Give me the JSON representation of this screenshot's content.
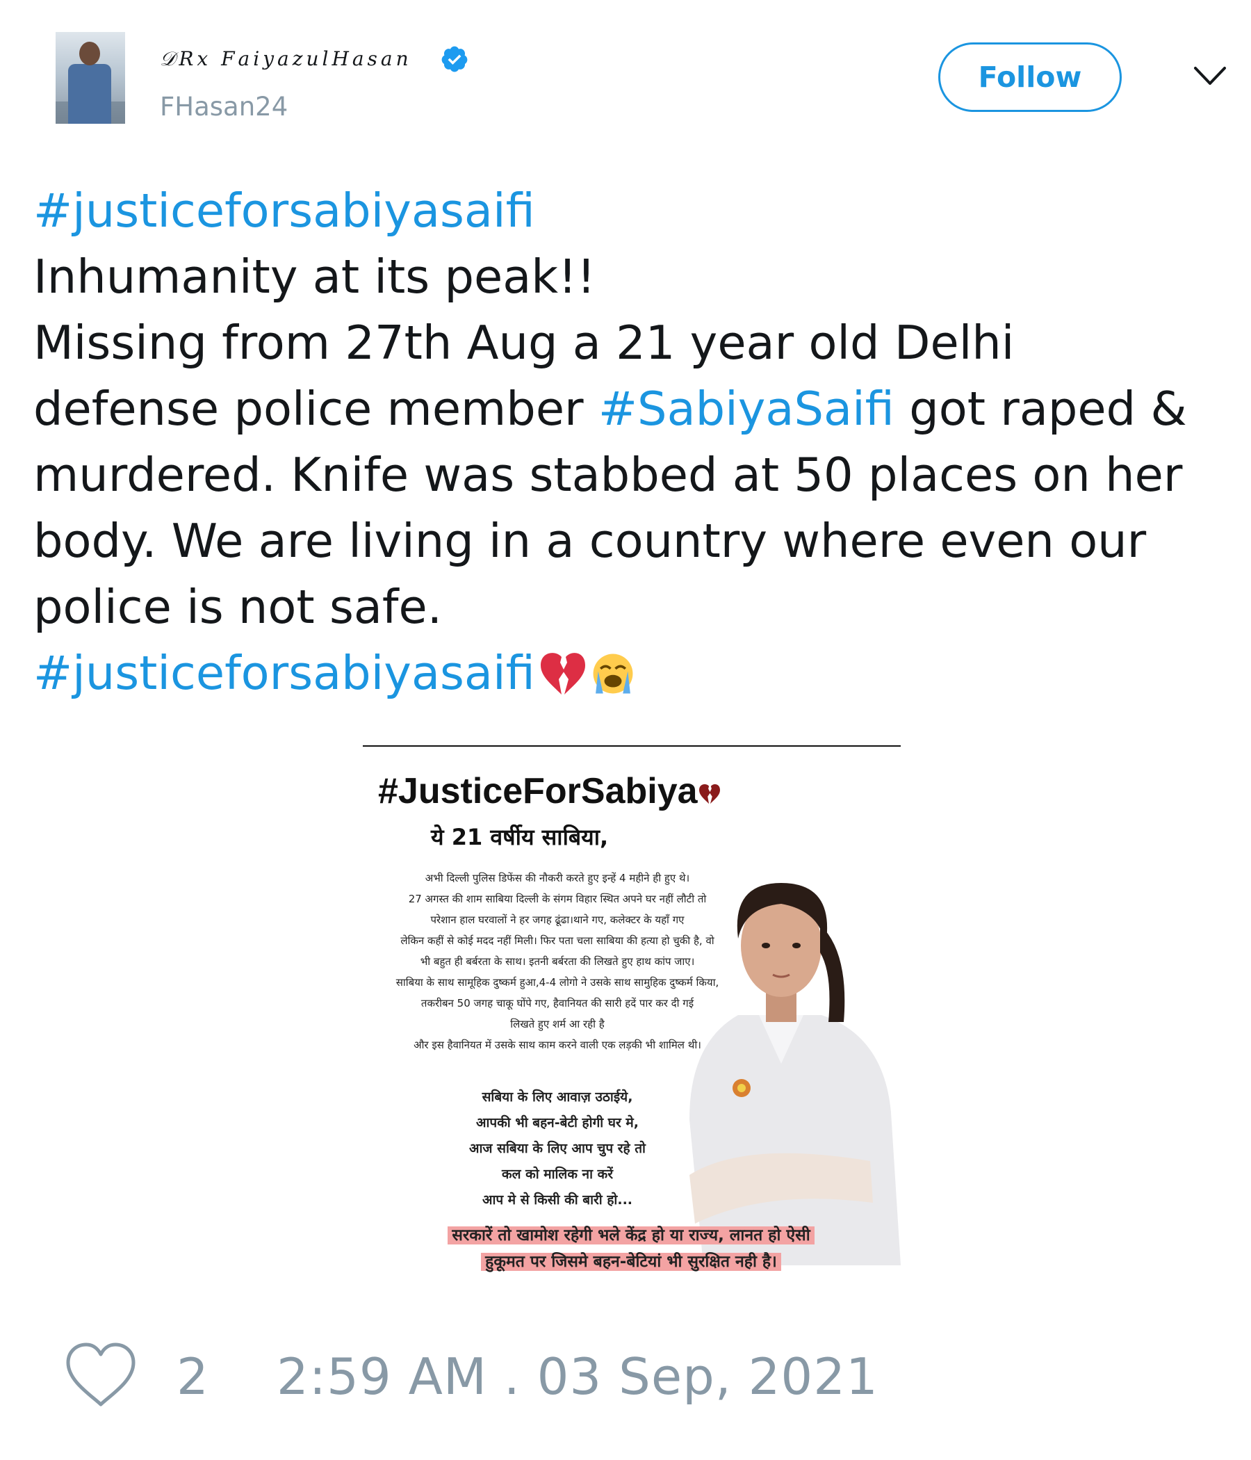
{
  "author": {
    "display_name": "𝒟Rx 𝐹𝑎𝑖𝑦𝑎𝑧𝑢𝑙𝐻𝑎𝑠𝑎𝑛",
    "handle": "FHasan24",
    "verified_icon": "verified-badge-icon"
  },
  "follow_label": "Follow",
  "menu_icon": "chevron-down-icon",
  "tweet": {
    "lines": [
      {
        "tag": "#justiceforsabiyasaifi"
      },
      {
        "text": "Inhumanity at its peak!!"
      },
      {
        "text": "Missing from 27th Aug a 21 year old Delhi"
      },
      {
        "pre": "defense police member ",
        "tag": "#SabiyaSaifi",
        "post": " got raped &"
      },
      {
        "text": "murdered. Knife was stabbed at 50 places on her"
      },
      {
        "text": "body. We are living in a country where even our"
      },
      {
        "text": "police is not safe."
      },
      {
        "tag": "#justiceforsabiyasaifi"
      }
    ],
    "emojis": [
      "broken-heart-icon",
      "loudly-crying-face-icon"
    ]
  },
  "media": {
    "title": "#JusticeForSabiya",
    "subtitle": "ये 21 वर्षीय साबिया,",
    "body_lines": [
      "अभी दिल्ली पुलिस डिफेंस की नौकरी करते हुए इन्हें 4 महीने ही हुए थे।",
      "27 अगस्त की शाम साबिया दिल्ली के संगम विहार स्थित अपने घर नहीं लौटी तो",
      "परेशान हाल घरवालों ने हर जगह ढूंढा।थाने गए, कलेक्टर के यहाँ गए",
      "लेकिन कहीं से कोई मदद नहीं मिली। फिर पता चला साबिया की हत्या हो चुकी है, वो",
      "भी बहुत ही बर्बरता के साथ। इतनी बर्बरता की लिखते हुए हाथ कांप जाए।",
      "साबिया के साथ सामूहिक दुष्कर्म हुआ,4-4 लोगो ने उसके साथ सामुहिक दुष्कर्म किया,",
      "तकरीबन 50 जगह चाकू घोंपे गए, हैवानियत की सारी हदें पार कर दी गई",
      "लिखते हुए शर्म आ रही है",
      "और इस हैवानियत में उसके साथ काम करने वाली एक लड़की भी शामिल थी।"
    ],
    "appeal_lines": [
      "सबिया के लिए आवाज़ उठाईये,",
      "आपकी भी बहन-बेटी होगी घर मे,",
      "आज सबिया के लिए आप चुप रहे तो",
      "कल को मालिक ना करें",
      "आप मे से किसी की बारी हो..."
    ],
    "banner_lines": [
      "सरकारें तो खामोश रहेगी भले केंद्र हो या राज्य, लानत हो ऐसी",
      "हुकूमत पर जिसमे बहन-बेटियां भी सुरक्षित नही है।"
    ]
  },
  "footer": {
    "heart_icon": "heart-icon",
    "like_count": "2",
    "timestamp": "2:59 AM . 03 Sep, 2021"
  },
  "colors": {
    "link": "#1b95e0",
    "muted": "#8899a6",
    "text": "#14171a",
    "banner_highlight": "#f3a3a3"
  }
}
